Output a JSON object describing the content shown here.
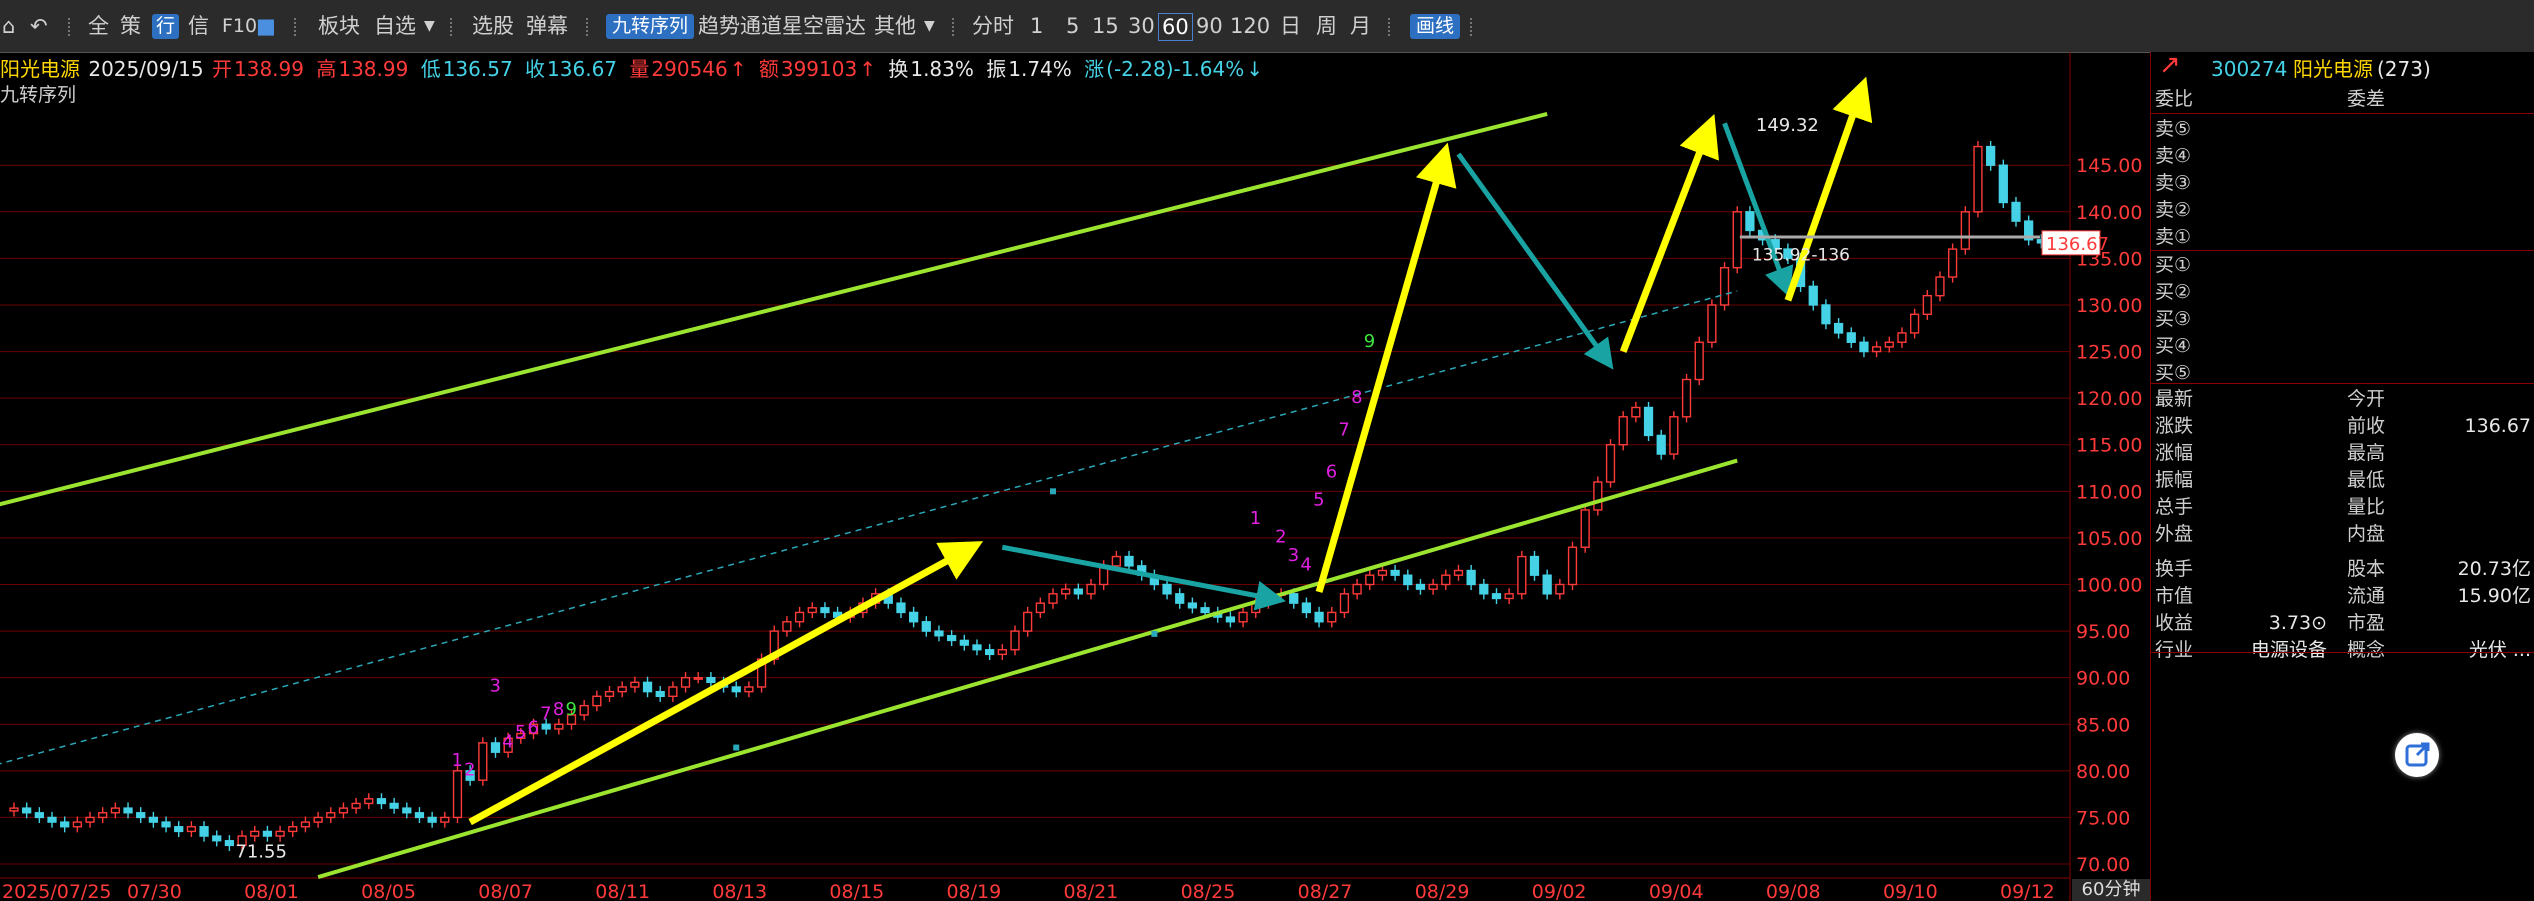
{
  "toolbar": {
    "items": [
      "全",
      "策",
      "信",
      "板块",
      "自选",
      "选股",
      "弹幕",
      "趋势通道",
      "星空雷达",
      "其他",
      "分时"
    ],
    "hang_label": "行",
    "f10_label": "F10",
    "jiuzhuan_label": "九转序列",
    "periods": [
      "1",
      "5",
      "15",
      "30",
      "60",
      "90",
      "120",
      "日",
      "周",
      "月"
    ],
    "selected_period": "60",
    "draw_label": "画线"
  },
  "info": {
    "name": "阳光电源",
    "date": "2025/09/15",
    "open_label": "开",
    "open": "138.99",
    "high_label": "高",
    "high": "138.99",
    "low_label": "低",
    "low": "136.57",
    "close_label": "收",
    "close": "136.67",
    "vol_label": "量",
    "vol": "290546",
    "amt_label": "额",
    "amt": "399103",
    "turnover_label": "换",
    "turnover": "1.83%",
    "amp_label": "振",
    "amp": "1.74%",
    "chg_label": "涨",
    "chg": "(-2.28)-1.64%",
    "subtitle": "九转序列"
  },
  "chart_data": {
    "type": "candlestick",
    "timeframe": "60分钟",
    "ylim": [
      68.5,
      152.0
    ],
    "y_ticks": [
      "145.00",
      "140.00",
      "135.00",
      "130.00",
      "125.00",
      "120.00",
      "115.00",
      "110.00",
      "105.00",
      "100.00",
      "95.00",
      "90.00",
      "85.00",
      "80.00",
      "75.00",
      "70.00"
    ],
    "x_labels": [
      "2025/07/25",
      "07/30",
      "08/01",
      "08/05",
      "08/07",
      "08/11",
      "08/13",
      "08/15",
      "08/19",
      "08/21",
      "08/25",
      "08/27",
      "08/29",
      "09/02",
      "09/04",
      "09/08",
      "09/10",
      "09/12"
    ],
    "annotations": {
      "low_label": "71.55",
      "high_label": "149.32",
      "range_label": "135.92-136",
      "last_price": "136.67",
      "nine_seq_a": [
        "1",
        "2",
        "3",
        "4",
        "5",
        "6",
        "7",
        "8",
        "9"
      ],
      "nine_seq_b": [
        "1",
        "2",
        "3",
        "4",
        "5",
        "6",
        "7",
        "8",
        "9"
      ]
    },
    "closes": [
      76,
      75.5,
      75,
      74.5,
      74,
      74.5,
      75,
      75.5,
      76,
      75.5,
      75,
      74.5,
      74,
      73.5,
      74,
      73,
      72.5,
      72,
      73,
      73.5,
      73,
      73.5,
      74,
      74.5,
      75,
      75.5,
      76,
      76.5,
      77,
      76.5,
      76,
      75.5,
      75,
      74.5,
      75,
      80,
      79,
      83,
      82,
      83.5,
      84,
      85,
      84.5,
      85,
      86,
      87,
      88,
      88.5,
      89,
      89.5,
      88.5,
      88,
      89,
      90,
      90,
      89.5,
      89,
      88.5,
      89,
      92,
      95,
      96,
      97,
      97.5,
      97,
      96.5,
      97,
      98,
      99,
      98,
      97,
      96,
      95,
      94.5,
      94,
      93.5,
      93,
      92.5,
      93,
      95,
      97,
      98,
      99,
      99.5,
      99,
      100,
      102,
      103,
      102,
      101,
      100,
      99,
      98,
      97.5,
      97,
      96.5,
      96,
      97,
      98,
      99,
      99,
      98,
      97,
      96,
      97,
      99,
      100,
      101,
      101.5,
      101,
      100,
      99.5,
      100,
      101,
      101.5,
      100,
      99,
      98.5,
      99,
      103,
      101,
      99,
      100,
      104,
      108,
      111,
      115,
      118,
      119,
      116,
      114,
      118,
      122,
      126,
      130,
      134,
      140,
      138,
      137,
      136,
      135,
      132,
      130,
      128,
      127,
      126,
      125,
      125.5,
      126,
      127,
      129,
      131,
      133,
      136,
      140,
      147,
      145,
      141,
      139,
      137,
      136.67
    ]
  },
  "right_panel": {
    "code": "300274",
    "name": "阳光电源",
    "count": "(273)",
    "weibi_label": "委比",
    "weicha_label": "委差",
    "sell_labels": [
      "卖⑤",
      "卖④",
      "卖③",
      "卖②",
      "卖①"
    ],
    "buy_labels": [
      "买①",
      "买②",
      "买③",
      "买④",
      "买⑤"
    ],
    "rows": [
      {
        "l1": "最新",
        "v1": "",
        "l2": "今开",
        "v2": ""
      },
      {
        "l1": "涨跌",
        "v1": "",
        "l2": "前收",
        "v2": "136.67"
      },
      {
        "l1": "涨幅",
        "v1": "",
        "l2": "最高",
        "v2": ""
      },
      {
        "l1": "振幅",
        "v1": "",
        "l2": "最低",
        "v2": ""
      },
      {
        "l1": "总手",
        "v1": "",
        "l2": "量比",
        "v2": ""
      },
      {
        "l1": "外盘",
        "v1": "",
        "l2": "内盘",
        "v2": ""
      },
      {
        "l1": "换手",
        "v1": "",
        "l2": "股本",
        "v2": "20.73亿"
      },
      {
        "l1": "市值",
        "v1": "",
        "l2": "流通",
        "v2": "15.90亿"
      },
      {
        "l1": "收益",
        "v1": "3.73⊙",
        "l2": "市盈",
        "v2": ""
      },
      {
        "l1": "行业",
        "v1": "电源设备",
        "l2": "概念",
        "v2": "光伏 ..."
      }
    ]
  },
  "bottom_tag": "60分钟",
  "colors": {
    "up": "#ff3a3a",
    "down": "#45d2e6",
    "channel": "#9be530",
    "arrow_up": "#ffff00",
    "arrow_down": "#1aa3a3",
    "grid": "#6a0000"
  }
}
